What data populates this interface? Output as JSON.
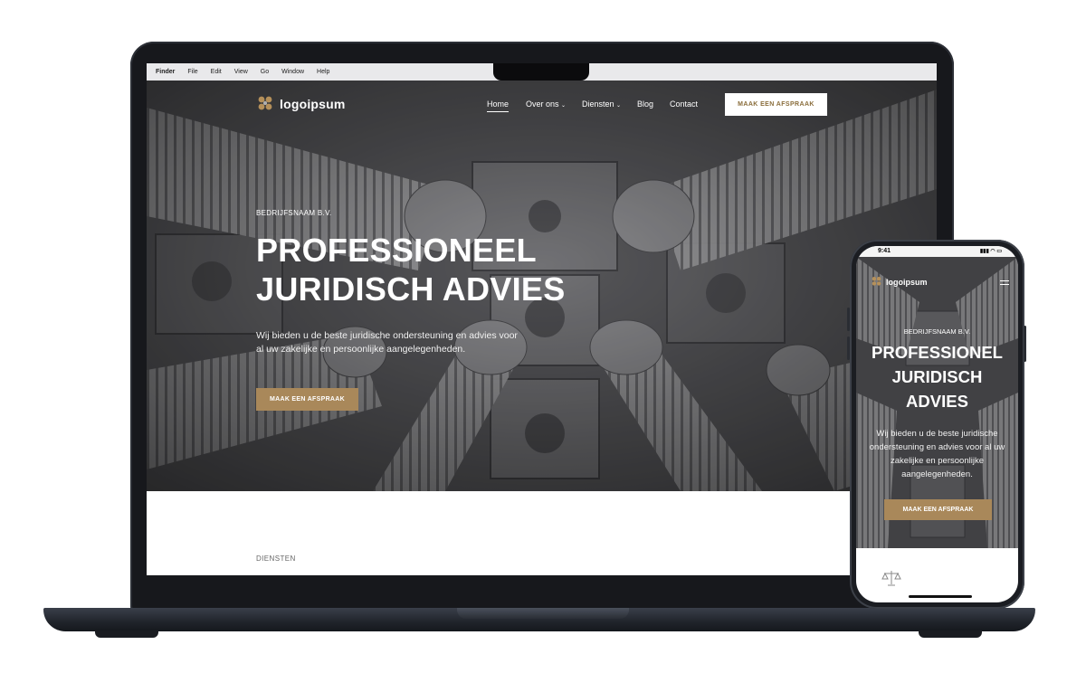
{
  "menubar": {
    "items": [
      "Finder",
      "File",
      "Edit",
      "View",
      "Go",
      "Window",
      "Help"
    ]
  },
  "site": {
    "logo_text": "logoipsum",
    "logo_mark": "logo-hexagons-icon",
    "nav": {
      "home": "Home",
      "about": "Over ons",
      "services": "Diensten",
      "blog": "Blog",
      "contact": "Contact"
    },
    "cta_label": "MAAK EEN AFSPRAAK",
    "eyebrow": "BEDRIJFSNAAM B.V.",
    "title_line1": "PROFESSIONEEL",
    "title_line2": "JURIDISCH ADVIES",
    "subtitle": "Wij bieden u de beste juridische ondersteuning en advies voor al uw zakelijke en persoonlijke aangelegenheden.",
    "section_label": "DIENSTEN"
  },
  "phone": {
    "time": "9:41",
    "status_icons": "▮▮▮ ◠ ▭",
    "title_line1": "PROFESSIONEL",
    "title_line2": "JURIDISCH",
    "title_line3": "ADVIES",
    "section_icon": "scales-icon"
  },
  "colors": {
    "accent_gold": "#a9885a",
    "cta_text_gold": "#8a6d3b",
    "device_dark": "#17181c"
  }
}
